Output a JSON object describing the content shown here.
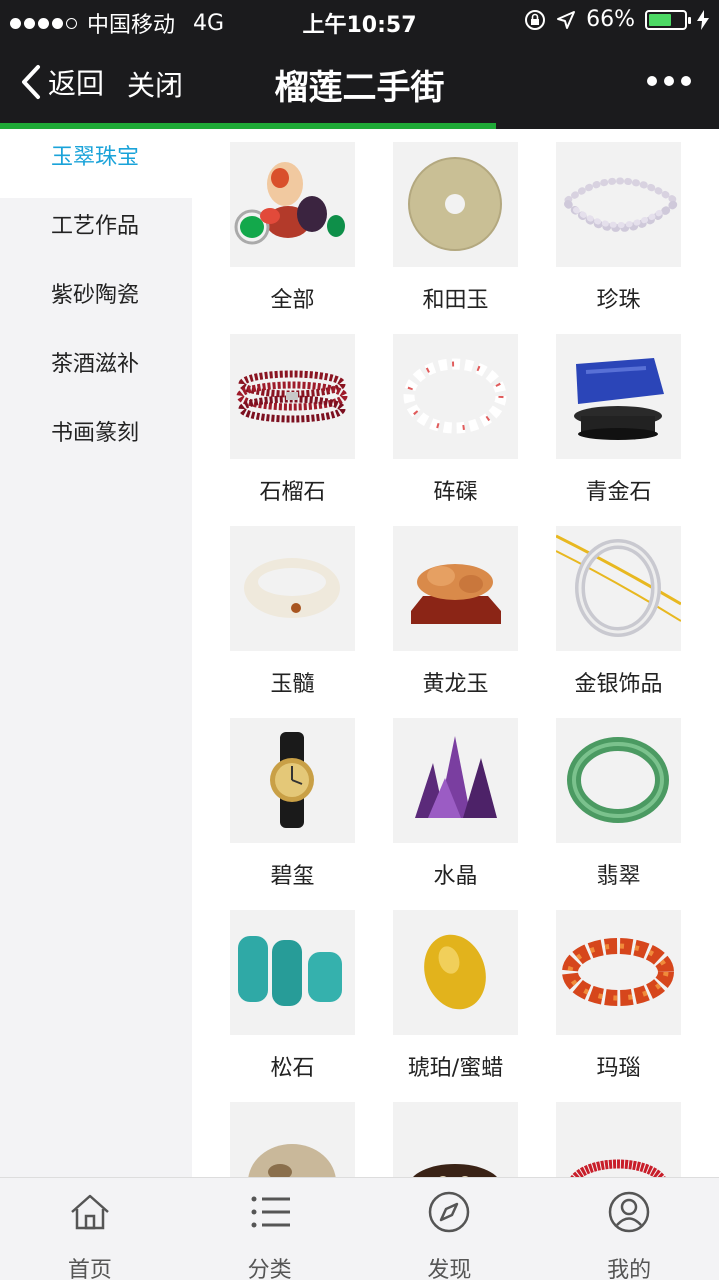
{
  "status_bar": {
    "carrier": "中国移动",
    "network": "4G",
    "time": "上午10:57",
    "battery_percent": "66%",
    "battery_level": 0.66,
    "battery_color": "#4cd964"
  },
  "nav": {
    "back_label": "返回",
    "close_label": "关闭",
    "title": "榴莲二手街",
    "progress": 0.69,
    "progress_color": "#1faa37"
  },
  "sidebar": {
    "items": [
      {
        "label": "玉翠珠宝",
        "active": true
      },
      {
        "label": "工艺作品",
        "active": false
      },
      {
        "label": "紫砂陶瓷",
        "active": false
      },
      {
        "label": "茶酒滋补",
        "active": false
      },
      {
        "label": "书画篆刻",
        "active": false
      }
    ],
    "active_color": "#1aa3d9"
  },
  "categories": [
    {
      "label": "全部",
      "icon": "mixed-gems-icon"
    },
    {
      "label": "和田玉",
      "icon": "jade-disc-icon"
    },
    {
      "label": "珍珠",
      "icon": "pearl-necklace-icon"
    },
    {
      "label": "石榴石",
      "icon": "garnet-bracelet-icon"
    },
    {
      "label": "砗磲",
      "icon": "tridacna-bracelet-icon"
    },
    {
      "label": "青金石",
      "icon": "lapis-stone-icon"
    },
    {
      "label": "玉髓",
      "icon": "chalcedony-bangle-icon"
    },
    {
      "label": "黄龙玉",
      "icon": "yellow-jade-carving-icon"
    },
    {
      "label": "金银饰品",
      "icon": "silver-bangle-icon"
    },
    {
      "label": "碧玺",
      "icon": "tourmaline-watch-icon"
    },
    {
      "label": "水晶",
      "icon": "amethyst-crystal-icon"
    },
    {
      "label": "翡翠",
      "icon": "jadeite-bangle-icon"
    },
    {
      "label": "松石",
      "icon": "turquoise-beads-icon"
    },
    {
      "label": "琥珀/蜜蜡",
      "icon": "amber-stone-icon"
    },
    {
      "label": "玛瑙",
      "icon": "agate-bracelet-icon"
    },
    {
      "label": "",
      "icon": "carved-stone-icon"
    },
    {
      "label": "",
      "icon": "dzi-bead-icon"
    },
    {
      "label": "",
      "icon": "red-coral-icon"
    }
  ],
  "tabbar": {
    "items": [
      {
        "label": "首页",
        "icon": "home-icon"
      },
      {
        "label": "分类",
        "icon": "list-icon"
      },
      {
        "label": "发现",
        "icon": "compass-icon"
      },
      {
        "label": "我的",
        "icon": "user-icon"
      }
    ]
  }
}
